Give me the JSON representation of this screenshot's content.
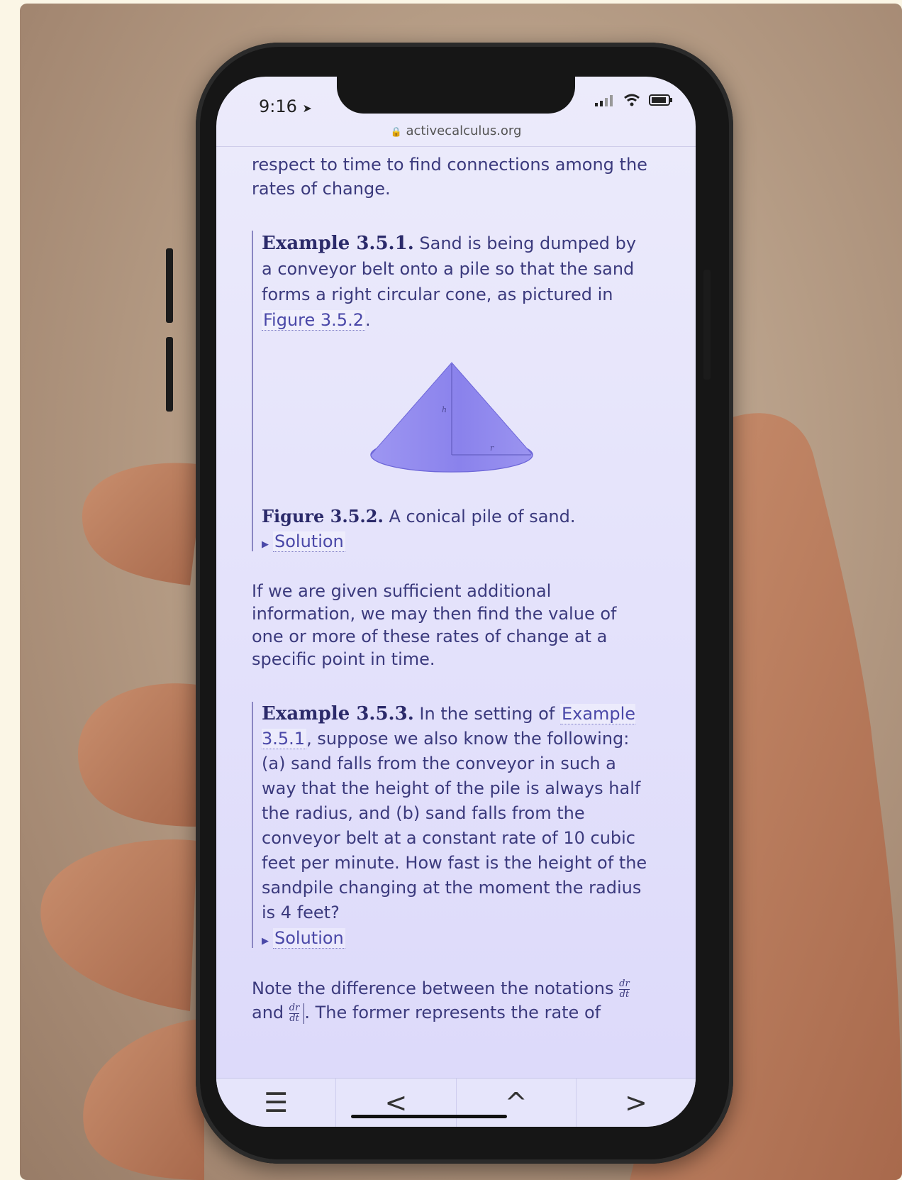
{
  "status": {
    "time": "9:16"
  },
  "browser": {
    "url": "activecalculus.org"
  },
  "content": {
    "intro": "respect to time to find connections among the rates of change.",
    "example1": {
      "title": "Example 3.5.1.",
      "text_before_link": "Sand is being dumped by a conveyor belt onto a pile so that the sand forms a right circular cone, as pictured in",
      "link": "Figure 3.5.2",
      "text_after_link": "."
    },
    "figure": {
      "label": "Figure 3.5.2.",
      "caption": "A conical pile of sand.",
      "height_label": "h",
      "radius_label": "r"
    },
    "solution_label": "Solution",
    "paragraph2": "If we are given sufficient additional information, we may then find the value of one or more of these rates of change at a specific point in time.",
    "example3": {
      "title": "Example 3.5.3.",
      "text_before_link": "In the setting of",
      "link": "Example 3.5.1",
      "text_after_link": ", suppose we also know the following: (a) sand falls from the conveyor in such a way that the height of the pile is always half the radius, and (b) sand falls from the conveyor belt at a constant rate of 10 cubic feet per minute. How fast is the height of the sandpile changing at the moment the radius is 4 feet?"
    },
    "note": {
      "text_start": "Note the difference between the notations",
      "and": "and",
      "text_end": ". The former represents the rate of",
      "frac_num": "dr",
      "frac_den": "dt"
    }
  },
  "toolbar": {
    "menu_glyph": "☰",
    "prev_glyph": "<",
    "up_glyph": "^",
    "next_glyph": ">"
  },
  "colors": {
    "screen_tint": "#e4e2fb",
    "text": "#3b3a7d",
    "cone": "#8f88ee"
  }
}
